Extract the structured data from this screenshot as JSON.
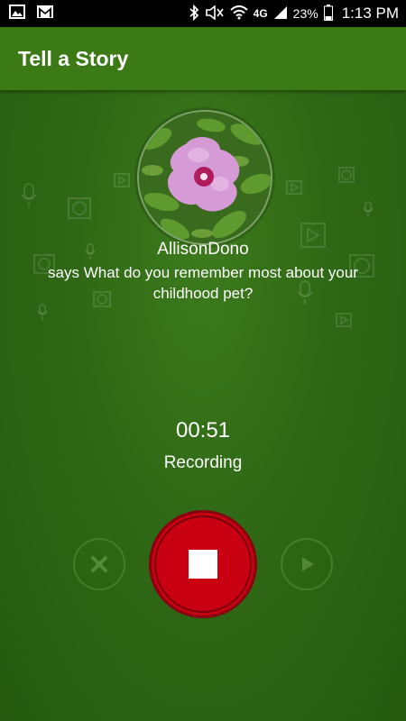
{
  "status_bar": {
    "battery": "23%",
    "network": "4G",
    "time": "1:13 PM",
    "icons": [
      "gallery-icon",
      "gmail-icon",
      "bluetooth-icon",
      "mute-icon",
      "wifi-icon",
      "signal-icon",
      "battery-icon"
    ]
  },
  "app_bar": {
    "title": "Tell a Story"
  },
  "story": {
    "user_name": "AllisonDono",
    "prompt": "says What do you remember most about your childhood pet?"
  },
  "recorder": {
    "timer": "00:51",
    "status": "Recording"
  },
  "colors": {
    "app_bar": "#3b7a14",
    "background": "#2f6815",
    "stop_button": "#c80012"
  }
}
